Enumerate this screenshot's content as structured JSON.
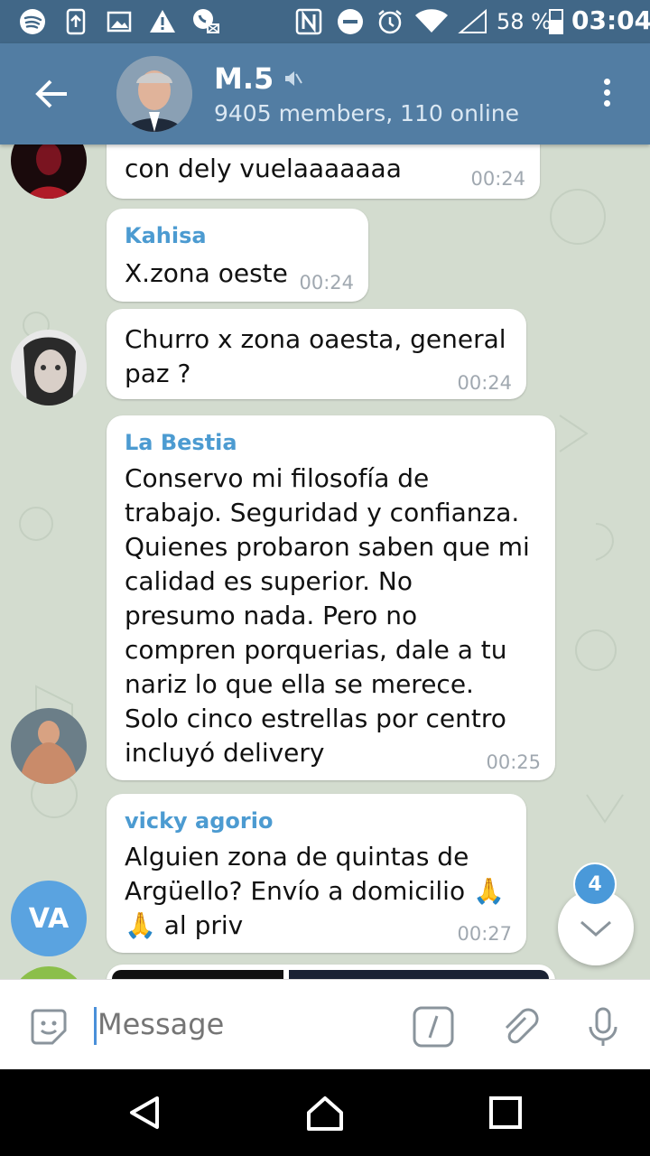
{
  "status_bar": {
    "battery_percent": "58 %",
    "battery_level": 0.58,
    "time": "03:04"
  },
  "header": {
    "title": "M.5",
    "subtitle": "9405 members, 110 online"
  },
  "messages": [
    {
      "sender": "",
      "text": "con dely vuelaaaaaaa",
      "time": "00:24"
    },
    {
      "sender": "Kahisa",
      "text": "X.zona oeste",
      "time": "00:24"
    },
    {
      "sender": "",
      "text": "Churro x zona oaesta, general\npaz ?",
      "time": "00:24"
    },
    {
      "sender": "La Bestia",
      "text": "Conservo mi filosofía de\ntrabajo. Seguridad y confianza.\nQuienes probaron saben que mi\ncalidad es superior. No\npresumo nada. Pero no\ncompren porquerias, dale a tu\nnariz lo que ella se merece.\nSolo cinco estrellas por centro\nincluyó delivery",
      "time": "00:25"
    },
    {
      "sender": "vicky agorio",
      "text": "Alguien zona de quintas de\nArgüello? Envío a domicilio 🙏\n🙏 al priv",
      "time": "00:27",
      "avatar_initials": "VA"
    }
  ],
  "unread_count": "4",
  "input": {
    "placeholder": "Message"
  },
  "colors": {
    "header": "#527da3",
    "statusbar": "#416787",
    "sender_name": "#4c9bd1",
    "avatar_va": "#5aa3e0"
  }
}
